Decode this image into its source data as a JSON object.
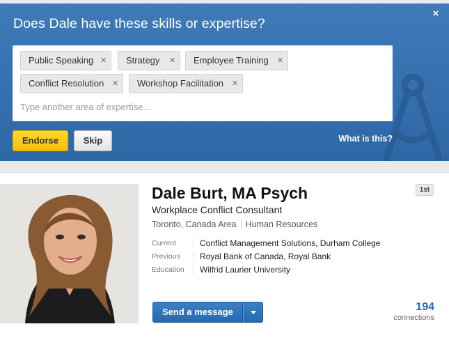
{
  "endorse": {
    "title": "Does Dale have these skills or expertise?",
    "close_glyph": "×",
    "skills": [
      {
        "label": "Public Speaking"
      },
      {
        "label": "Strategy"
      },
      {
        "label": "Employee Training"
      },
      {
        "label": "Conflict Resolution"
      },
      {
        "label": "Workshop Facilitation"
      }
    ],
    "remove_glyph": "×",
    "input_placeholder": "Type another area of expertise...",
    "endorse_label": "Endorse",
    "skip_label": "Skip",
    "what_is_this": "What is this?",
    "colors": {
      "banner": "#3f7ab9",
      "endorse_button": "#f6c513"
    }
  },
  "profile": {
    "name": "Dale Burt, MA Psych",
    "degree_badge": "1st",
    "headline": "Workplace Conflict Consultant",
    "location": "Toronto, Canada Area",
    "industry": "Human Resources",
    "details": [
      {
        "label": "Current",
        "value": "Conflict Management Solutions, Durham College"
      },
      {
        "label": "Previous",
        "value": "Royal Bank of Canada, Royal Bank"
      },
      {
        "label": "Education",
        "value": "Wilfrid Laurier University"
      }
    ],
    "message_button": "Send a message",
    "connections_count": "194",
    "connections_label": "connections",
    "colors": {
      "link": "#2b6aa8",
      "message_button": "#2f74ba"
    }
  }
}
